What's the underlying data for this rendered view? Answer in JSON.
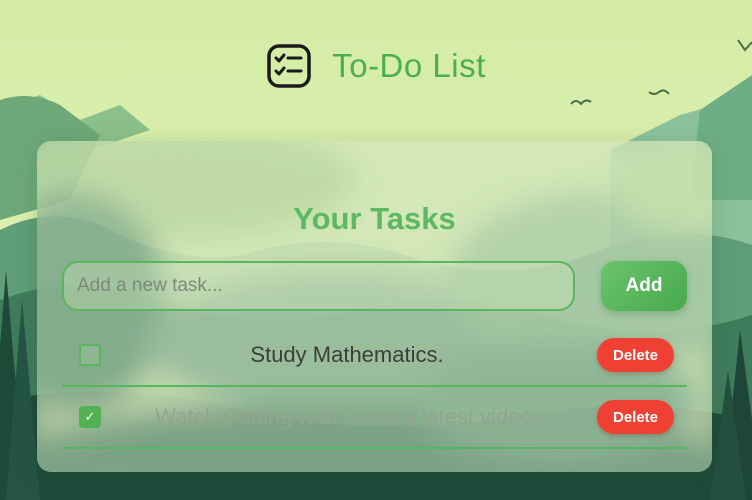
{
  "header": {
    "title": "To-Do List",
    "icon": "checklist-icon"
  },
  "card": {
    "title": "Your Tasks",
    "input": {
      "placeholder": "Add a new task...",
      "value": ""
    },
    "add_label": "Add"
  },
  "tasks": [
    {
      "text": "Study Mathematics.",
      "completed": false,
      "delete_label": "Delete"
    },
    {
      "text": "Watch Coding with Lewis's latest video.",
      "completed": true,
      "delete_label": "Delete"
    }
  ],
  "colors": {
    "accent_green": "#4cae52",
    "delete_red": "#ef4034",
    "sky": "#d6ecab"
  }
}
